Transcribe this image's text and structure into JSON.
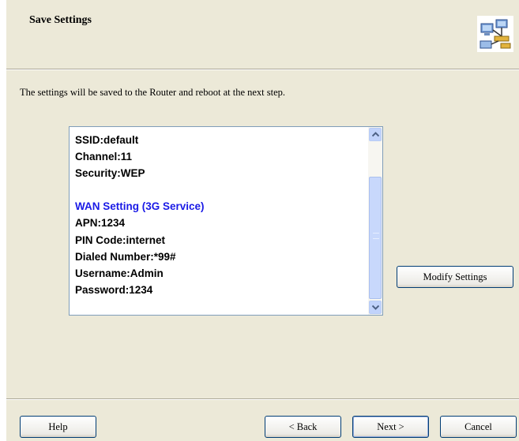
{
  "header": {
    "title": "Save Settings",
    "icon": "network-wizard-icon"
  },
  "instruction": "The settings will be saved to the Router and reboot at the next step.",
  "settings_list": [
    {
      "text": "SSID:default",
      "type": "item"
    },
    {
      "text": "Channel:11",
      "type": "item"
    },
    {
      "text": "Security:WEP",
      "type": "item"
    },
    {
      "text": "",
      "type": "blank"
    },
    {
      "text": "WAN Setting  (3G Service)",
      "type": "section"
    },
    {
      "text": "APN:1234",
      "type": "item"
    },
    {
      "text": "PIN Code:internet",
      "type": "item"
    },
    {
      "text": "Dialed Number:*99#",
      "type": "item"
    },
    {
      "text": "Username:Admin",
      "type": "item"
    },
    {
      "text": "Password:1234",
      "type": "item"
    }
  ],
  "colors": {
    "section": "#1a1ae6",
    "panel": "#ece9d8"
  },
  "buttons": {
    "modify": "Modify Settings",
    "help": "Help",
    "back": "< Back",
    "next": "Next >",
    "cancel": "Cancel"
  }
}
